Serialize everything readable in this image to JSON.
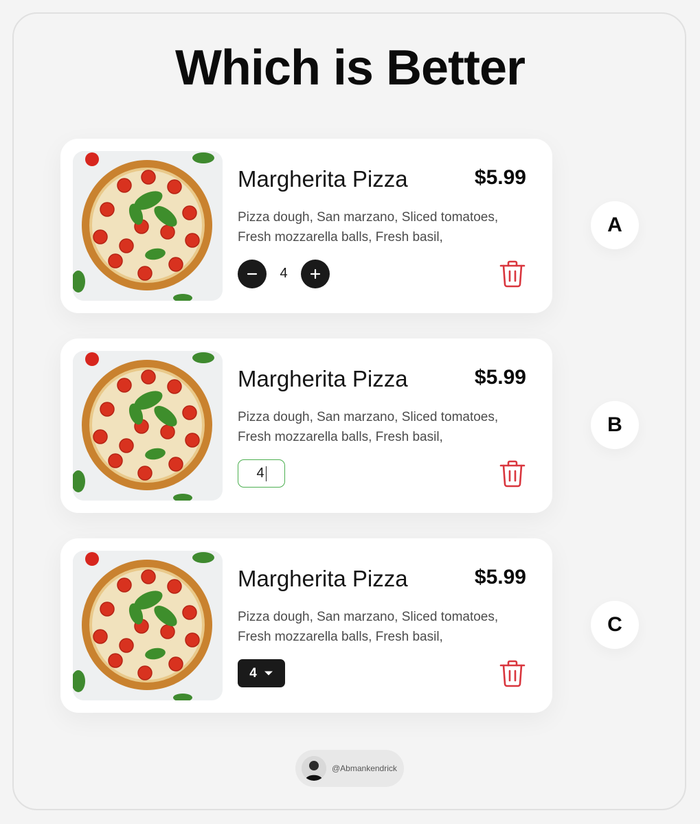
{
  "page": {
    "title": "Which is Better"
  },
  "product": {
    "name": "Margherita Pizza",
    "price": "$5.99",
    "description": "Pizza dough, San marzano, Sliced tomatoes, Fresh mozzarella balls, Fresh basil,"
  },
  "variants": [
    {
      "label": "A",
      "quantity_control": "stepper",
      "quantity": "4"
    },
    {
      "label": "B",
      "quantity_control": "text-input",
      "quantity": "4"
    },
    {
      "label": "C",
      "quantity_control": "dropdown",
      "quantity": "4"
    }
  ],
  "icons": {
    "decrement": "minus-icon",
    "increment": "plus-icon",
    "delete": "trash-icon",
    "dropdown": "caret-down-icon"
  },
  "colors": {
    "background": "#f4f4f4",
    "card": "#ffffff",
    "dark_control": "#1a1a1a",
    "delete_red": "#d9363e",
    "input_focus_green": "#4caf50"
  },
  "credit": {
    "handle": "@Abmankendrick"
  }
}
